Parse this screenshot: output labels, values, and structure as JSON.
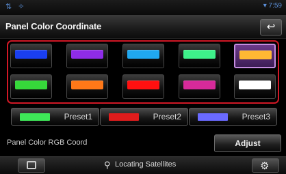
{
  "header": {
    "title": "Panel Color Coordinate",
    "status_left": "⇅ ✧",
    "status_right": "▾ 7:59"
  },
  "color_grid": [
    {
      "color": "#1a3ff0"
    },
    {
      "color": "#8f2ce8"
    },
    {
      "color": "#20a8f0"
    },
    {
      "color": "#3ef08a"
    },
    {
      "color": "#ffb833"
    },
    {
      "color": "#36d83a"
    },
    {
      "color": "#ff7818"
    },
    {
      "color": "#ff1010"
    },
    {
      "color": "#d62a9a"
    },
    {
      "color": "#ffffff"
    }
  ],
  "selected_index": 4,
  "presets": [
    {
      "label": "Preset1",
      "color": "#3ee858"
    },
    {
      "label": "Preset2",
      "color": "#e01c1c"
    },
    {
      "label": "Preset3",
      "color": "#6a6aff"
    }
  ],
  "rgb": {
    "label": "Panel Color RGB Coord",
    "adjust_label": "Adjust"
  },
  "bottom": {
    "status": "Locating Satellites",
    "left_icon": "nav-map-icon",
    "right_icon": "gear-icon"
  }
}
